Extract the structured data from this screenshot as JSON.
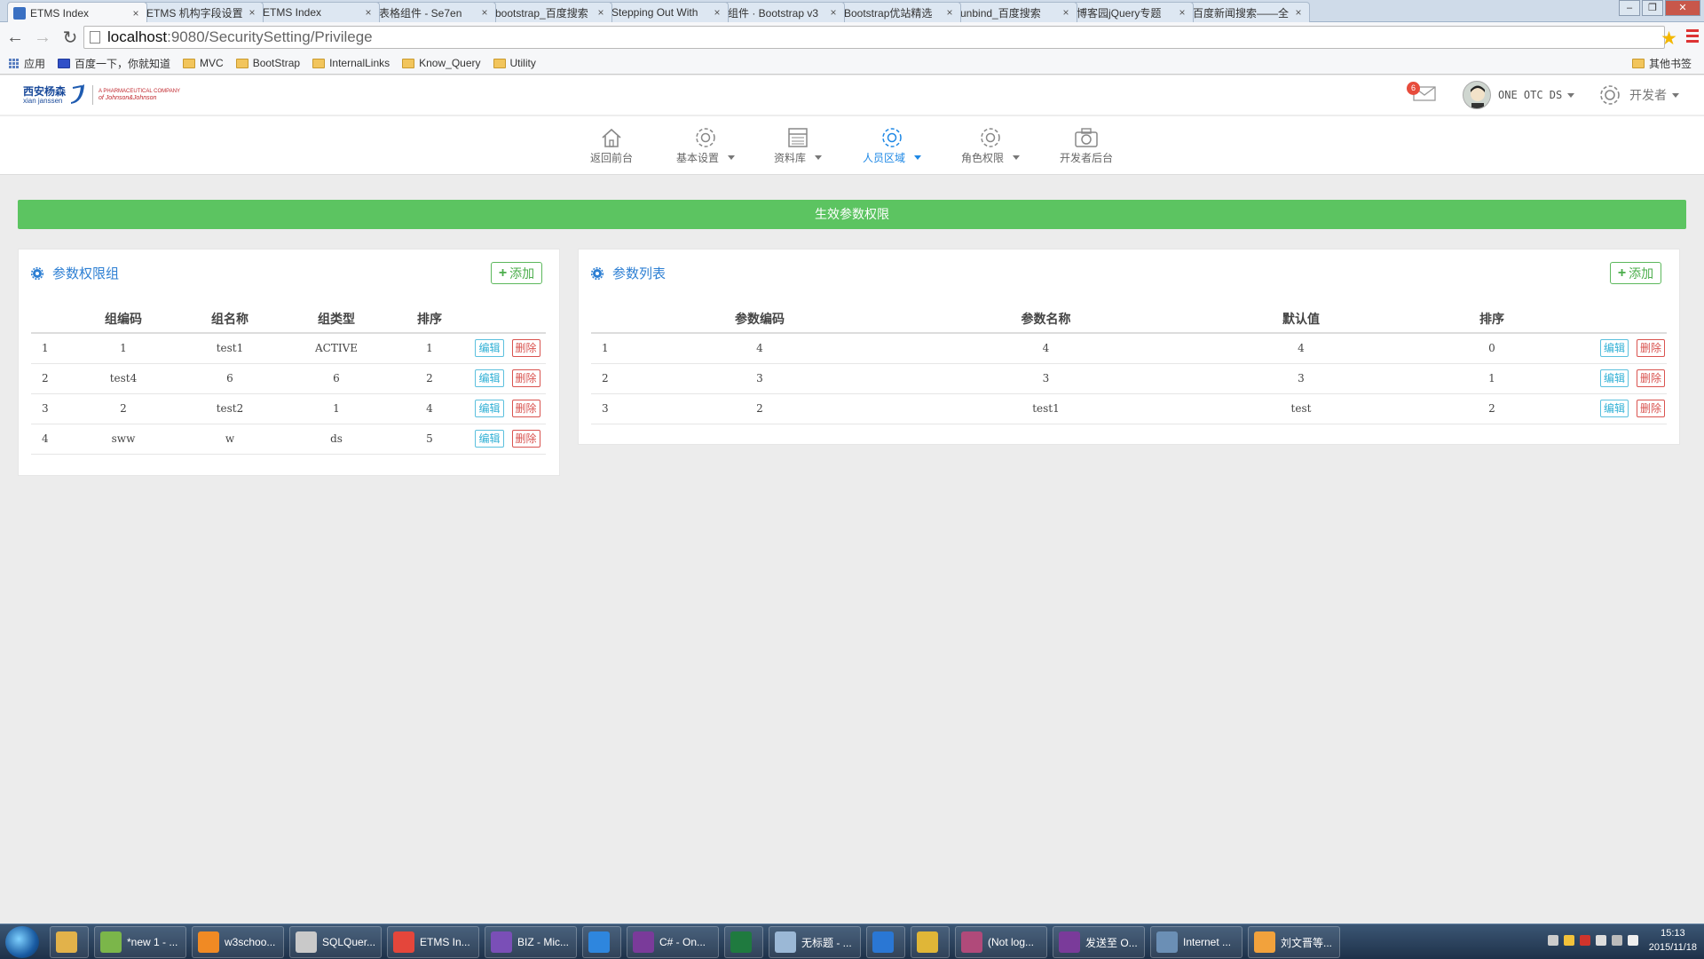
{
  "browser": {
    "tabs": [
      {
        "title": "ETMS Index",
        "color": "#3a70c2",
        "glyph": ""
      },
      {
        "title": "ETMS 机构字段设置",
        "color": "#3a70c2",
        "glyph": ""
      },
      {
        "title": "ETMS Index",
        "color": "#3a70c2",
        "glyph": ""
      },
      {
        "title": "表格组件 - Se7en",
        "color": "#2fb34a",
        "glyph": "Z"
      },
      {
        "title": "bootstrap_百度搜索",
        "color": "#3050c8",
        "glyph": "du"
      },
      {
        "title": "Stepping Out With",
        "color": "#e05a3c",
        "glyph": "+"
      },
      {
        "title": "组件 · Bootstrap v3",
        "color": "#563d7c",
        "glyph": "B"
      },
      {
        "title": "Bootstrap优站精选",
        "color": "#6a4fa0",
        "glyph": "◆"
      },
      {
        "title": "unbind_百度搜索",
        "color": "#3050c8",
        "glyph": "du"
      },
      {
        "title": "博客园jQuery专题",
        "color": "#2e7fd1",
        "glyph": "J"
      },
      {
        "title": "百度新闻搜索——全",
        "color": "#3050c8",
        "glyph": "du"
      }
    ],
    "url_host": "localhost",
    "url_path": ":9080/SecuritySetting/Privilege",
    "bookmarks": [
      "应用",
      "百度一下，你就知道",
      "MVC",
      "BootStrap",
      "InternalLinks",
      "Know_Query",
      "Utility"
    ],
    "other_bookmarks": "其他书签"
  },
  "header": {
    "logo_cn": "西安杨森",
    "logo_en": "xian janssen",
    "logo_jj_line1": "A PHARMACEUTICAL COMPANY",
    "logo_jj_line2": "of Johnson&Johnson",
    "mail_count": "6",
    "user_name": "ONE OTC DS",
    "role": "开发者"
  },
  "nav": {
    "items": [
      {
        "label": "返回前台",
        "icon": "home-icon",
        "caret": false
      },
      {
        "label": "基本设置",
        "icon": "gear-icon",
        "caret": true
      },
      {
        "label": "资料库",
        "icon": "calendar-icon",
        "caret": true
      },
      {
        "label": "人员区域",
        "icon": "gear-icon",
        "caret": true,
        "active": true
      },
      {
        "label": "角色权限",
        "icon": "gear-icon",
        "caret": true
      },
      {
        "label": "开发者后台",
        "icon": "camera-icon",
        "caret": false
      }
    ]
  },
  "banner": {
    "label": "生效参数权限",
    "color": "#5cc461"
  },
  "left_panel": {
    "title": "参数权限组",
    "add_label": "添加",
    "columns": [
      "",
      "组编码",
      "组名称",
      "组类型",
      "排序",
      ""
    ],
    "rows": [
      [
        "1",
        "1",
        "test1",
        "ACTIVE",
        "1"
      ],
      [
        "2",
        "test4",
        "6",
        "6",
        "2"
      ],
      [
        "3",
        "2",
        "test2",
        "1",
        "4"
      ],
      [
        "4",
        "sww",
        "w",
        "ds",
        "5"
      ]
    ],
    "edit_label": "编辑",
    "delete_label": "删除"
  },
  "right_panel": {
    "title": "参数列表",
    "add_label": "添加",
    "columns": [
      "",
      "参数编码",
      "参数名称",
      "默认值",
      "排序",
      ""
    ],
    "rows": [
      [
        "1",
        "4",
        "4",
        "4",
        "0"
      ],
      [
        "2",
        "3",
        "3",
        "3",
        "1"
      ],
      [
        "3",
        "2",
        "test1",
        "test",
        "2"
      ]
    ],
    "edit_label": "编辑",
    "delete_label": "删除"
  },
  "taskbar": {
    "items": [
      {
        "label": "",
        "color": "#e2b24a"
      },
      {
        "label": "*new 1 - ...",
        "color": "#7bb64a"
      },
      {
        "label": "w3schoo...",
        "color": "#f08a24"
      },
      {
        "label": "SQLQuer...",
        "color": "#c9c9c9"
      },
      {
        "label": "ETMS In...",
        "color": "#e4463b"
      },
      {
        "label": "BIZ - Mic...",
        "color": "#7a4fb7"
      },
      {
        "label": "",
        "color": "#2e86de"
      },
      {
        "label": "C# - On...",
        "color": "#7a3b9a"
      },
      {
        "label": "",
        "color": "#1f7a3f"
      },
      {
        "label": "无标题 - ...",
        "color": "#9bb8d6"
      },
      {
        "label": "",
        "color": "#2a77d4"
      },
      {
        "label": "",
        "color": "#e0b637"
      },
      {
        "label": "(Not log...",
        "color": "#b04a7a"
      },
      {
        "label": "发送至 O...",
        "color": "#7a3b9a"
      },
      {
        "label": "Internet ...",
        "color": "#6b8fb5"
      },
      {
        "label": "刘文晋等...",
        "color": "#f2a23c"
      }
    ],
    "time": "15:13",
    "date": "2015/11/18"
  }
}
